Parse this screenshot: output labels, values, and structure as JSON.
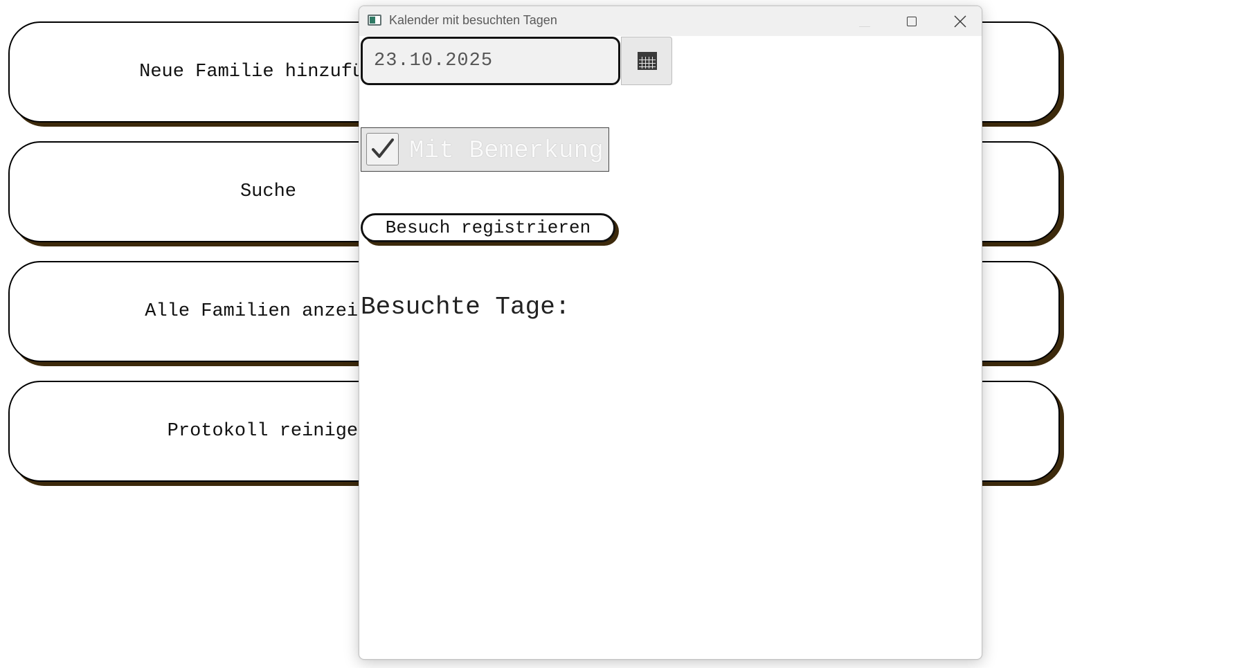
{
  "main": {
    "buttons": [
      {
        "label": "Neue Familie hinzufügen"
      },
      {
        "label": "Suche"
      },
      {
        "label": "Alle Familien anzeigen"
      },
      {
        "label": "Protokoll reinigen"
      }
    ]
  },
  "dialog": {
    "title": "Kalender mit besuchten Tagen",
    "date_value": "23.10.2025",
    "calendar_icon": "calendar-icon",
    "checkbox": {
      "label": "Mit Bemerkung",
      "checked": true
    },
    "register_label": "Besuch registrieren",
    "visited_heading": "Besuchte Tage:",
    "window_controls": [
      "minimize-icon",
      "maximize-icon",
      "close-icon"
    ]
  },
  "colors": {
    "button_shadow": "#3d2a0c",
    "titlebar": "#f0f0f0",
    "app_icon_accent": "#2f7a65"
  }
}
